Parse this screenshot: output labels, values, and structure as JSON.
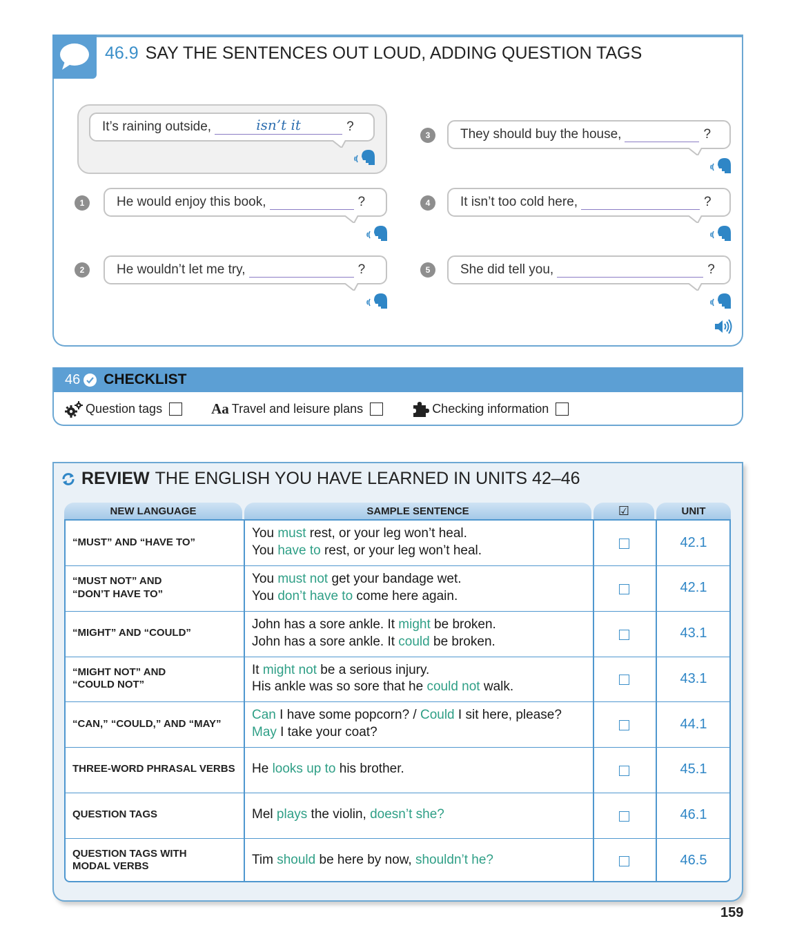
{
  "exercise": {
    "number": "46.9",
    "title": "SAY THE SENTENCES OUT LOUD, ADDING QUESTION TAGS",
    "example": {
      "text": "It’s raining outside,",
      "answer": "isn’t it",
      "end": "?"
    },
    "items": [
      {
        "num": "1",
        "text": "He would enjoy this book,",
        "end": "?"
      },
      {
        "num": "2",
        "text": "He wouldn’t let me try,",
        "end": "?"
      },
      {
        "num": "3",
        "text": "They should buy the house,",
        "end": "?"
      },
      {
        "num": "4",
        "text": "It isn’t too cold here,",
        "end": "?"
      },
      {
        "num": "5",
        "text": "She did tell you,",
        "end": "?"
      }
    ]
  },
  "checklist": {
    "number": "46",
    "title": "CHECKLIST",
    "items": [
      {
        "icon": "gears-icon",
        "label": "Question tags"
      },
      {
        "icon_text": "Aa",
        "label": "Travel and leisure plans"
      },
      {
        "icon": "puzzle-icon",
        "label": "Checking information"
      }
    ]
  },
  "review": {
    "title_bold": "REVIEW",
    "title_rest": "THE ENGLISH YOU HAVE LEARNED IN UNITS 42–46",
    "headers": {
      "language": "NEW LANGUAGE",
      "sentence": "SAMPLE SENTENCE",
      "check": "☑",
      "unit": "UNIT"
    },
    "rows": [
      {
        "lang": [
          "“MUST” AND “HAVE TO”"
        ],
        "lines": [
          [
            {
              "t": "You "
            },
            {
              "t": "must",
              "h": true
            },
            {
              "t": " rest, or your leg won’t heal."
            }
          ],
          [
            {
              "t": "You "
            },
            {
              "t": "have to",
              "h": true
            },
            {
              "t": " rest, or your leg won’t heal."
            }
          ]
        ],
        "unit": "42.1"
      },
      {
        "lang": [
          "“MUST NOT” AND",
          "“DON’T HAVE TO”"
        ],
        "lines": [
          [
            {
              "t": "You "
            },
            {
              "t": "must not",
              "h": true
            },
            {
              "t": " get your bandage wet."
            }
          ],
          [
            {
              "t": "You "
            },
            {
              "t": "don’t have to",
              "h": true
            },
            {
              "t": " come here again."
            }
          ]
        ],
        "unit": "42.1"
      },
      {
        "lang": [
          "“MIGHT” AND “COULD”"
        ],
        "lines": [
          [
            {
              "t": "John has a sore ankle. It "
            },
            {
              "t": "might",
              "h": true
            },
            {
              "t": " be broken."
            }
          ],
          [
            {
              "t": "John has a sore ankle. It "
            },
            {
              "t": "could",
              "h": true
            },
            {
              "t": " be broken."
            }
          ]
        ],
        "unit": "43.1"
      },
      {
        "lang": [
          "“MIGHT NOT” AND",
          "“COULD NOT”"
        ],
        "lines": [
          [
            {
              "t": "It "
            },
            {
              "t": "might not",
              "h": true
            },
            {
              "t": " be a serious injury."
            }
          ],
          [
            {
              "t": "His ankle was so sore that he "
            },
            {
              "t": "could not",
              "h": true
            },
            {
              "t": " walk."
            }
          ]
        ],
        "unit": "43.1"
      },
      {
        "lang": [
          "“CAN,” “COULD,” AND “MAY”"
        ],
        "lines": [
          [
            {
              "t": "Can",
              "h": true
            },
            {
              "t": " I have some popcorn? / "
            },
            {
              "t": "Could",
              "h": true
            },
            {
              "t": " I sit here, please?"
            }
          ],
          [
            {
              "t": "May",
              "h": true
            },
            {
              "t": " I take your coat?"
            }
          ]
        ],
        "unit": "44.1"
      },
      {
        "lang": [
          "THREE-WORD PHRASAL VERBS"
        ],
        "lines": [
          [
            {
              "t": "He "
            },
            {
              "t": "looks up to",
              "h": true
            },
            {
              "t": " his brother."
            }
          ]
        ],
        "unit": "45.1"
      },
      {
        "lang": [
          "QUESTION TAGS"
        ],
        "lines": [
          [
            {
              "t": "Mel "
            },
            {
              "t": "plays",
              "h": true
            },
            {
              "t": " the violin, "
            },
            {
              "t": "doesn’t she?",
              "h": true
            }
          ]
        ],
        "unit": "46.1"
      },
      {
        "lang": [
          "QUESTION TAGS WITH",
          "MODAL VERBS"
        ],
        "lines": [
          [
            {
              "t": "Tim "
            },
            {
              "t": "should",
              "h": true
            },
            {
              "t": " be here by now, "
            },
            {
              "t": "shouldn’t he?",
              "h": true
            }
          ]
        ],
        "unit": "46.5"
      }
    ]
  },
  "page_number": "159",
  "colors": {
    "accent": "#5b9fd4",
    "highlight": "#2f9f86",
    "unit": "#2f86c6",
    "blank_line": "#8a7bc4"
  }
}
